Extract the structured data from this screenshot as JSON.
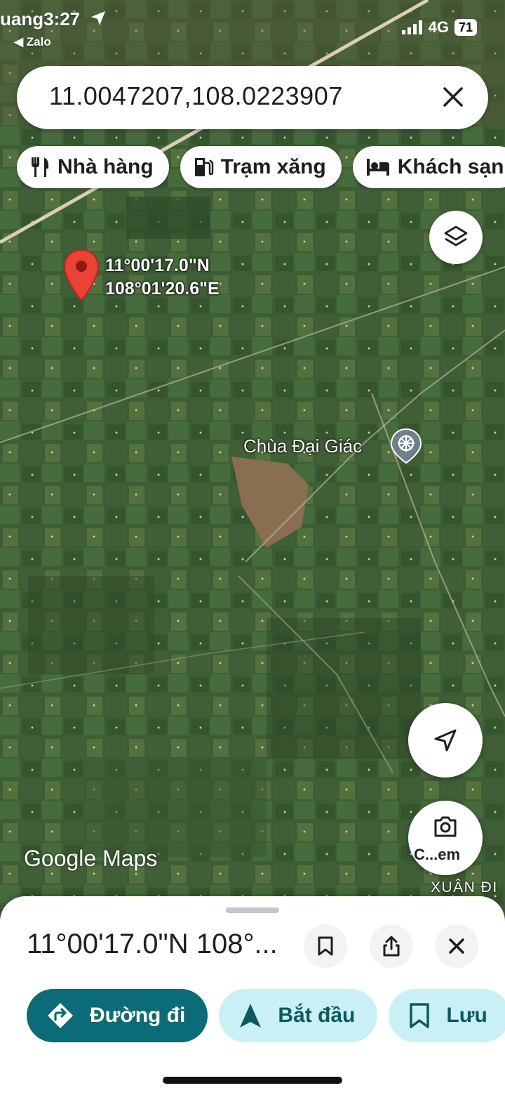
{
  "status_bar": {
    "time": "uang3:27",
    "back_app": "◀ Zalo",
    "network": "4G",
    "battery": "71"
  },
  "search": {
    "query": "11.0047207,108.0223907"
  },
  "chips": [
    {
      "label": "Nhà hàng",
      "icon": "restaurant-icon"
    },
    {
      "label": "Trạm xăng",
      "icon": "gas-station-icon"
    },
    {
      "label": "Khách sạn",
      "icon": "hotel-icon"
    }
  ],
  "map": {
    "pin_lat": "11°00'17.0\"N",
    "pin_lng": "108°01'20.6\"E",
    "poi_name": "Chùa Đại Giác",
    "poi_icon": "temple-icon",
    "watermark": "Google Maps",
    "area_label": "XUÂN ĐI",
    "camera_label": "C...em"
  },
  "sheet": {
    "title": "11°00'17.0\"N 108°...",
    "actions": [
      {
        "label": "Đường đi",
        "icon": "directions-icon"
      },
      {
        "label": "Bắt đầu",
        "icon": "navigation-icon"
      },
      {
        "label": "Lưu",
        "icon": "bookmark-icon"
      }
    ]
  },
  "colors": {
    "primary": "#0b6b76",
    "secondary_bg": "#c9f0f5",
    "pin": "#ea4335"
  }
}
